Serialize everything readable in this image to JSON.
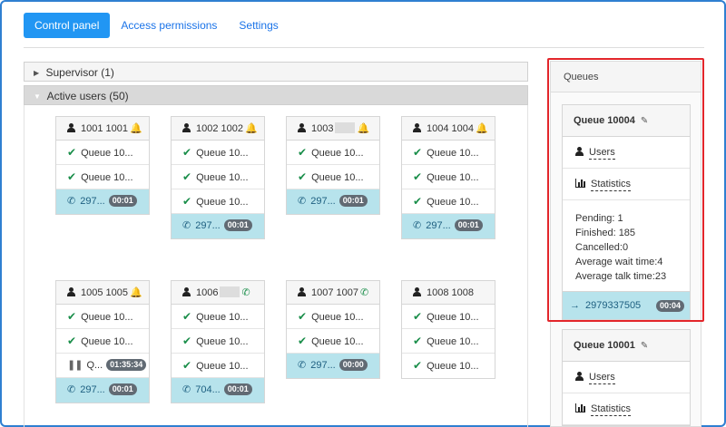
{
  "tabs": [
    {
      "label": "Control panel",
      "active": true
    },
    {
      "label": "Access permissions",
      "active": false
    },
    {
      "label": "Settings",
      "active": false
    }
  ],
  "sections": {
    "supervisor": "Supervisor (1)",
    "active_users": "Active users (50)"
  },
  "users": [
    {
      "name": "1001 1001",
      "status_icon": "bell-icon",
      "rows": [
        {
          "type": "queue",
          "text": "Queue 10..."
        },
        {
          "type": "queue",
          "text": "Queue 10..."
        },
        {
          "type": "call",
          "text": "297...",
          "timer": "00:01"
        }
      ]
    },
    {
      "name": "1002 1002",
      "status_icon": "bell-icon",
      "rows": [
        {
          "type": "queue",
          "text": "Queue 10..."
        },
        {
          "type": "queue",
          "text": "Queue 10..."
        },
        {
          "type": "queue",
          "text": "Queue 10..."
        },
        {
          "type": "call",
          "text": "297...",
          "timer": "00:01"
        }
      ]
    },
    {
      "name": "1003",
      "status_icon": "bell-icon",
      "redacted": true,
      "rows": [
        {
          "type": "queue",
          "text": "Queue 10..."
        },
        {
          "type": "queue",
          "text": "Queue 10..."
        },
        {
          "type": "call",
          "text": "297...",
          "timer": "00:01"
        }
      ]
    },
    {
      "name": "1004 1004",
      "status_icon": "bell-icon",
      "rows": [
        {
          "type": "queue",
          "text": "Queue 10..."
        },
        {
          "type": "queue",
          "text": "Queue 10..."
        },
        {
          "type": "queue",
          "text": "Queue 10..."
        },
        {
          "type": "call",
          "text": "297...",
          "timer": "00:01"
        }
      ]
    },
    {
      "name": "1005 1005",
      "status_icon": "bell-icon",
      "rows": [
        {
          "type": "queue",
          "text": "Queue 10..."
        },
        {
          "type": "queue",
          "text": "Queue 10..."
        },
        {
          "type": "paused",
          "text": "Q...",
          "timer": "01:35:34"
        },
        {
          "type": "call",
          "text": "297...",
          "timer": "00:01"
        }
      ]
    },
    {
      "name": "1006",
      "status_icon": "phone-icon",
      "redacted": true,
      "rows": [
        {
          "type": "queue",
          "text": "Queue 10..."
        },
        {
          "type": "queue",
          "text": "Queue 10..."
        },
        {
          "type": "queue",
          "text": "Queue 10..."
        },
        {
          "type": "call",
          "text": "704...",
          "timer": "00:01"
        }
      ]
    },
    {
      "name": "1007 1007",
      "status_icon": "phone-icon",
      "rows": [
        {
          "type": "queue",
          "text": "Queue 10..."
        },
        {
          "type": "queue",
          "text": "Queue 10..."
        },
        {
          "type": "call",
          "text": "297...",
          "timer": "00:00"
        }
      ]
    },
    {
      "name": "1008 1008",
      "status_icon": "",
      "rows": [
        {
          "type": "queue",
          "text": "Queue 10..."
        },
        {
          "type": "queue",
          "text": "Queue 10..."
        },
        {
          "type": "queue",
          "text": "Queue 10..."
        }
      ]
    }
  ],
  "queues": {
    "title": "Queues",
    "items": [
      {
        "name": "Queue 10004",
        "users_label": "Users",
        "statistics_label": "Statistics",
        "stats": [
          "Pending: 1",
          "Finished: 185",
          "Cancelled:0",
          "Average wait time:4",
          "Average talk time:23"
        ],
        "call": {
          "number": "2979337505",
          "timer": "00:04"
        }
      },
      {
        "name": "Queue 10001",
        "users_label": "Users",
        "statistics_label": "Statistics"
      }
    ]
  },
  "colors": {
    "accent": "#2196f3",
    "highlight": "#e3262b",
    "call_bg": "#b7e3ec",
    "ok_green": "#1a8e4a"
  }
}
